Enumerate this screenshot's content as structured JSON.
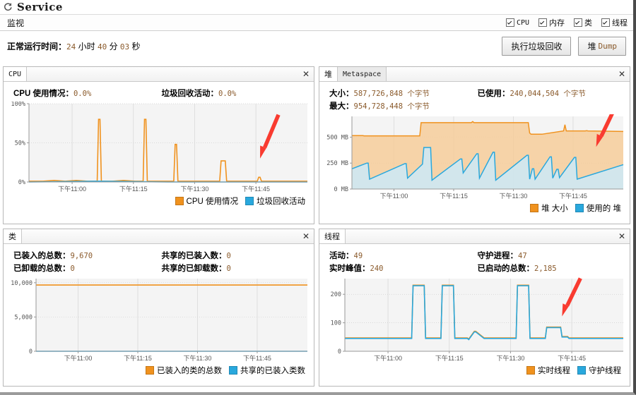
{
  "window": {
    "title": "Service",
    "icon": "refresh-circle-icon"
  },
  "menubar": {
    "label": "监视",
    "checkboxes": [
      {
        "label": "CPU",
        "checked": true,
        "mono": true
      },
      {
        "label": "内存",
        "checked": true,
        "mono": false
      },
      {
        "label": "类",
        "checked": true,
        "mono": false
      },
      {
        "label": "线程",
        "checked": true,
        "mono": false
      }
    ]
  },
  "uptime": {
    "label": "正常运行时间：",
    "hours": "24",
    "hours_unit": "小时",
    "minutes": "40",
    "minutes_unit": "分",
    "seconds": "03",
    "seconds_unit": "秒"
  },
  "buttons": {
    "gc": "执行垃圾回收",
    "heapdump_prefix": "堆",
    "heapdump_mono": "Dump"
  },
  "colors": {
    "orange": "#f0921e",
    "blue": "#29a8dd",
    "orange_fill": "#f6cd9a",
    "blue_fill": "#cbe9f8",
    "arrow_red": "#f93b30",
    "plot_bg": "#f4f4f4",
    "value_text": "#8a5a2b"
  },
  "panels": {
    "cpu": {
      "title": "CPU",
      "close": "✕",
      "stats": [
        {
          "label": "CPU 使用情况：",
          "value": "0.0%"
        },
        {
          "label": "垃圾回收活动：",
          "value": "0.0%"
        }
      ],
      "legend": [
        {
          "label": "CPU 使用情况",
          "color": "#f0921e"
        },
        {
          "label": "垃圾回收活动",
          "color": "#29a8dd"
        }
      ],
      "chart_ref": 0
    },
    "heap": {
      "tabs": [
        {
          "label": "堆",
          "active": true,
          "mono": false
        },
        {
          "label": "Metaspace",
          "active": false,
          "mono": true
        }
      ],
      "close": "✕",
      "stats": [
        {
          "label": "大小：",
          "value": "587,726,848 个字节"
        },
        {
          "label": "已使用：",
          "value": "240,044,504 个字节"
        },
        {
          "label": "最大：",
          "value": "954,728,448 个字节"
        },
        {
          "label": "",
          "value": ""
        }
      ],
      "legend": [
        {
          "label": "堆 大小",
          "color": "#f0921e"
        },
        {
          "label": "使用的 堆",
          "color": "#29a8dd"
        }
      ],
      "chart_ref": 1
    },
    "classes": {
      "title": "类",
      "close": "✕",
      "stats": [
        {
          "label": "已装入的总数：",
          "value": "9,670"
        },
        {
          "label": "共享的已装入数：",
          "value": "0"
        },
        {
          "label": "已卸载的总数：",
          "value": "0"
        },
        {
          "label": "共享的已卸载数：",
          "value": "0"
        }
      ],
      "legend": [
        {
          "label": "已装入的类的总数",
          "color": "#f0921e"
        },
        {
          "label": "共享的已装入类数",
          "color": "#29a8dd"
        }
      ],
      "chart_ref": 2
    },
    "threads": {
      "title": "线程",
      "close": "✕",
      "stats": [
        {
          "label": "活动：",
          "value": "49"
        },
        {
          "label": "守护进程：",
          "value": "47"
        },
        {
          "label": "实时峰值：",
          "value": "240"
        },
        {
          "label": "已启动的总数：",
          "value": "2,185"
        }
      ],
      "legend": [
        {
          "label": "实时线程",
          "color": "#f0921e"
        },
        {
          "label": "守护线程",
          "color": "#29a8dd"
        }
      ],
      "chart_ref": 3
    }
  },
  "chart_data": [
    {
      "id": "cpu",
      "type": "line",
      "title": "CPU",
      "xlabel": "",
      "ylabel": "",
      "ylim": [
        0,
        100
      ],
      "yticks": [
        0,
        50,
        100
      ],
      "ytick_labels": [
        "0%",
        "50%",
        "100%"
      ],
      "xticks": [
        0.155,
        0.375,
        0.595,
        0.815
      ],
      "xtick_labels": [
        "下午11:00",
        "下午11:15",
        "下午11:30",
        "下午11:45"
      ],
      "grid": true,
      "annotation": {
        "type": "arrow",
        "color": "#f93b30",
        "points_at": 0.83
      },
      "series": [
        {
          "name": "CPU 使用情况",
          "color": "#f0921e",
          "x": [
            0.0,
            0.05,
            0.09,
            0.13,
            0.17,
            0.21,
            0.245,
            0.25,
            0.255,
            0.26,
            0.3,
            0.34,
            0.38,
            0.41,
            0.415,
            0.42,
            0.425,
            0.46,
            0.5,
            0.52,
            0.525,
            0.53,
            0.535,
            0.58,
            0.62,
            0.66,
            0.685,
            0.69,
            0.7,
            0.705,
            0.71,
            0.75,
            0.79,
            0.82,
            0.825,
            0.83,
            0.835,
            0.88,
            0.92,
            0.96,
            1.0
          ],
          "y": [
            1,
            1,
            2,
            1,
            2,
            1,
            1,
            80,
            80,
            1,
            1,
            2,
            1,
            1,
            80,
            80,
            1,
            1,
            1,
            1,
            48,
            48,
            1,
            1,
            1,
            1,
            1,
            27,
            27,
            27,
            1,
            1,
            1,
            1,
            6,
            6,
            1,
            1,
            1,
            1,
            1
          ]
        },
        {
          "name": "垃圾回收活动",
          "color": "#29a8dd",
          "x": [
            0.0,
            0.25,
            0.5,
            0.75,
            1.0
          ],
          "y": [
            0,
            1,
            0,
            0,
            0
          ]
        }
      ]
    },
    {
      "id": "heap",
      "type": "area",
      "title": "堆",
      "xlabel": "",
      "ylabel": "",
      "ylim": [
        0,
        700
      ],
      "yticks": [
        0,
        250,
        500
      ],
      "ytick_labels": [
        "0 MB",
        "250 MB",
        "500 MB"
      ],
      "xticks": [
        0.155,
        0.375,
        0.595,
        0.815
      ],
      "xtick_labels": [
        "下午11:00",
        "下午11:15",
        "下午11:30",
        "下午11:45"
      ],
      "grid": true,
      "annotation": {
        "type": "arrow",
        "color": "#f93b30",
        "points_at": 0.9
      },
      "series": [
        {
          "name": "堆 大小",
          "color": "#f0921e",
          "fill": "#f6cd9a",
          "x": [
            0.0,
            0.04,
            0.045,
            0.25,
            0.255,
            0.26,
            0.44,
            0.445,
            0.45,
            0.52,
            0.525,
            0.53,
            0.65,
            0.655,
            0.66,
            0.665,
            0.67,
            0.7,
            0.78,
            0.785,
            0.79,
            0.86,
            0.865,
            0.87,
            1.0
          ],
          "y": [
            515,
            515,
            512,
            512,
            640,
            640,
            640,
            650,
            640,
            640,
            640,
            640,
            640,
            540,
            528,
            528,
            528,
            528,
            560,
            620,
            560,
            560,
            562,
            560,
            555
          ]
        },
        {
          "name": "使用的 堆",
          "color": "#29a8dd",
          "fill": "#cbe9f8",
          "x": [
            0.0,
            0.055,
            0.06,
            0.065,
            0.195,
            0.2,
            0.205,
            0.26,
            0.265,
            0.27,
            0.285,
            0.29,
            0.295,
            0.4,
            0.405,
            0.41,
            0.46,
            0.465,
            0.47,
            0.52,
            0.525,
            0.53,
            0.645,
            0.65,
            0.655,
            0.665,
            0.67,
            0.675,
            0.73,
            0.735,
            0.74,
            0.755,
            0.76,
            0.765,
            0.82,
            0.825,
            0.83,
            1.0
          ],
          "y": [
            195,
            250,
            250,
            95,
            245,
            245,
            105,
            240,
            400,
            400,
            400,
            400,
            85,
            290,
            290,
            155,
            340,
            340,
            105,
            355,
            355,
            85,
            325,
            325,
            95,
            195,
            195,
            95,
            310,
            310,
            105,
            190,
            190,
            110,
            305,
            305,
            95,
            235
          ]
        }
      ]
    },
    {
      "id": "classes",
      "type": "line",
      "title": "类",
      "xlabel": "",
      "ylabel": "",
      "ylim": [
        0,
        10600
      ],
      "yticks": [
        0,
        5000,
        10000
      ],
      "ytick_labels": [
        "0",
        "5,000",
        "10,000"
      ],
      "xticks": [
        0.155,
        0.375,
        0.595,
        0.815
      ],
      "xtick_labels": [
        "下午11:00",
        "下午11:15",
        "下午11:30",
        "下午11:45"
      ],
      "grid": true,
      "annotation": null,
      "series": [
        {
          "name": "已装入的类的总数",
          "color": "#f0921e",
          "x": [
            0.0,
            0.5,
            1.0
          ],
          "y": [
            9670,
            9670,
            9670
          ]
        },
        {
          "name": "共享的已装入类数",
          "color": "#29a8dd",
          "x": [
            0.0,
            0.5,
            1.0
          ],
          "y": [
            0,
            0,
            0
          ]
        }
      ]
    },
    {
      "id": "threads",
      "type": "line",
      "title": "线程",
      "xlabel": "",
      "ylabel": "",
      "ylim": [
        0,
        255
      ],
      "yticks": [
        0,
        100,
        200
      ],
      "ytick_labels": [
        "0",
        "100",
        "200"
      ],
      "xticks": [
        0.155,
        0.375,
        0.595,
        0.815
      ],
      "xtick_labels": [
        "下午11:00",
        "下午11:15",
        "下午11:30",
        "下午11:45"
      ],
      "grid": true,
      "annotation": {
        "type": "arrow",
        "color": "#f93b30",
        "points_at": 0.78
      },
      "series": [
        {
          "name": "实时线程",
          "color": "#f0921e",
          "x": [
            0.0,
            0.24,
            0.245,
            0.285,
            0.29,
            0.345,
            0.35,
            0.39,
            0.395,
            0.44,
            0.445,
            0.465,
            0.47,
            0.5,
            0.505,
            0.615,
            0.62,
            0.66,
            0.665,
            0.72,
            0.725,
            0.775,
            0.78,
            0.8,
            0.805,
            1.0
          ],
          "y": [
            47,
            47,
            232,
            232,
            47,
            47,
            232,
            232,
            47,
            47,
            43,
            70,
            70,
            47,
            47,
            47,
            232,
            232,
            47,
            47,
            85,
            85,
            52,
            52,
            47,
            47
          ]
        },
        {
          "name": "守护线程",
          "color": "#29a8dd",
          "x": [
            0.0,
            0.24,
            0.245,
            0.285,
            0.29,
            0.345,
            0.35,
            0.39,
            0.395,
            0.44,
            0.445,
            0.465,
            0.47,
            0.5,
            0.505,
            0.615,
            0.62,
            0.66,
            0.665,
            0.72,
            0.725,
            0.775,
            0.78,
            0.8,
            0.805,
            1.0
          ],
          "y": [
            45,
            45,
            230,
            230,
            45,
            45,
            230,
            230,
            45,
            45,
            41,
            68,
            68,
            45,
            45,
            45,
            230,
            230,
            45,
            45,
            83,
            83,
            50,
            50,
            45,
            45
          ]
        }
      ]
    }
  ]
}
